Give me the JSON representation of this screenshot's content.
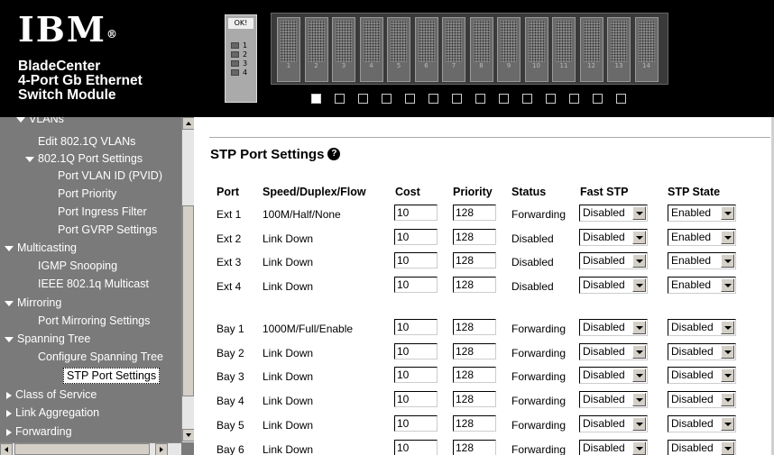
{
  "header": {
    "logo": "IBM",
    "product_lines": [
      "BladeCenter",
      "4-Port Gb Ethernet",
      "Switch Module"
    ],
    "module_ok": "OK!",
    "module_ports": [
      "1",
      "2",
      "3",
      "4"
    ],
    "bays": [
      "1",
      "2",
      "3",
      "4",
      "5",
      "6",
      "7",
      "8",
      "9",
      "10",
      "11",
      "12",
      "13",
      "14"
    ],
    "active_bay": 1
  },
  "sidebar": {
    "items": [
      {
        "label": "VLANs",
        "indent": 1,
        "icon": "triangle-down-icon"
      },
      {
        "label": "Edit 802.1Q VLANs",
        "indent": 2
      },
      {
        "label": "802.1Q Port Settings",
        "indent": 1.5,
        "icon": "triangle-down-icon"
      },
      {
        "label": "Port VLAN ID (PVID)",
        "indent": 3
      },
      {
        "label": "Port Priority",
        "indent": 3
      },
      {
        "label": "Port Ingress Filter",
        "indent": 3
      },
      {
        "label": "Port GVRP Settings",
        "indent": 3
      },
      {
        "label": "Multicasting",
        "indent": 0,
        "icon": "triangle-down-icon"
      },
      {
        "label": "IGMP Snooping",
        "indent": 2
      },
      {
        "label": "IEEE 802.1q Multicast",
        "indent": 2
      },
      {
        "label": "Mirroring",
        "indent": 0,
        "icon": "triangle-down-icon"
      },
      {
        "label": "Port Mirroring Settings",
        "indent": 2
      },
      {
        "label": "Spanning Tree",
        "indent": 0,
        "icon": "triangle-down-icon"
      },
      {
        "label": "Configure Spanning Tree",
        "indent": 2
      },
      {
        "label": "STP Port Settings",
        "indent": 2,
        "selected": true
      },
      {
        "label": "Class of Service",
        "indent": 0,
        "icon": "triangle-right-icon"
      },
      {
        "label": "Link Aggregation",
        "indent": 0,
        "icon": "triangle-right-icon"
      },
      {
        "label": "Forwarding",
        "indent": 0,
        "icon": "triangle-right-icon"
      }
    ]
  },
  "main": {
    "title": "STP Port Settings",
    "help_icon_glyph": "?",
    "columns": [
      "Port",
      "Speed/Duplex/Flow",
      "Cost",
      "Priority",
      "Status",
      "Fast STP",
      "STP State"
    ],
    "rows": [
      {
        "port": "Ext 1",
        "speed": "100M/Half/None",
        "cost": "10",
        "priority": "128",
        "status": "Forwarding",
        "fast_stp": "Disabled",
        "stp_state": "Enabled"
      },
      {
        "port": "Ext 2",
        "speed": "Link Down",
        "cost": "10",
        "priority": "128",
        "status": "Disabled",
        "fast_stp": "Disabled",
        "stp_state": "Enabled"
      },
      {
        "port": "Ext 3",
        "speed": "Link Down",
        "cost": "10",
        "priority": "128",
        "status": "Disabled",
        "fast_stp": "Disabled",
        "stp_state": "Enabled"
      },
      {
        "port": "Ext 4",
        "speed": "Link Down",
        "cost": "10",
        "priority": "128",
        "status": "Disabled",
        "fast_stp": "Disabled",
        "stp_state": "Enabled"
      },
      {
        "port": "Bay 1",
        "speed": "1000M/Full/Enable",
        "cost": "10",
        "priority": "128",
        "status": "Forwarding",
        "fast_stp": "Disabled",
        "stp_state": "Disabled"
      },
      {
        "port": "Bay 2",
        "speed": "Link Down",
        "cost": "10",
        "priority": "128",
        "status": "Forwarding",
        "fast_stp": "Disabled",
        "stp_state": "Disabled"
      },
      {
        "port": "Bay 3",
        "speed": "Link Down",
        "cost": "10",
        "priority": "128",
        "status": "Forwarding",
        "fast_stp": "Disabled",
        "stp_state": "Disabled"
      },
      {
        "port": "Bay 4",
        "speed": "Link Down",
        "cost": "10",
        "priority": "128",
        "status": "Forwarding",
        "fast_stp": "Disabled",
        "stp_state": "Disabled"
      },
      {
        "port": "Bay 5",
        "speed": "Link Down",
        "cost": "10",
        "priority": "128",
        "status": "Forwarding",
        "fast_stp": "Disabled",
        "stp_state": "Disabled"
      },
      {
        "port": "Bay 6",
        "speed": "Link Down",
        "cost": "10",
        "priority": "128",
        "status": "Forwarding",
        "fast_stp": "Disabled",
        "stp_state": "Disabled"
      }
    ]
  },
  "colors": {
    "header_bg": "#000000",
    "sidebar_bg": "#7a7a7a",
    "main_bg": "#ffffff"
  }
}
